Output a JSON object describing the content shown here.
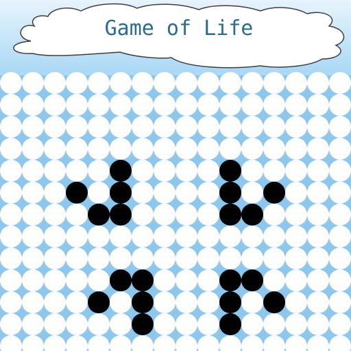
{
  "title": "Game of Life",
  "colors": {
    "background": "#8fc6ec",
    "dead_cell": "#ffffff",
    "alive_cell": "#000000",
    "title_text": "#2b6c8e",
    "cloud_fill": "#ffffff",
    "cloud_stroke": "#3d3d3d"
  },
  "board": {
    "rows": 13,
    "cols": 16,
    "live_cells": [
      [
        4,
        5
      ],
      [
        5,
        3
      ],
      [
        5,
        5
      ],
      [
        5,
        10
      ],
      [
        5,
        12
      ],
      [
        6,
        4
      ],
      [
        6,
        5
      ],
      [
        6,
        10
      ],
      [
        6,
        11
      ],
      [
        9,
        5
      ],
      [
        9,
        6
      ],
      [
        9,
        11
      ],
      [
        10,
        4
      ],
      [
        10,
        6
      ],
      [
        10,
        10
      ],
      [
        10,
        12
      ],
      [
        11,
        6
      ],
      [
        11,
        10
      ],
      [
        4,
        10
      ],
      [
        9,
        10
      ]
    ]
  }
}
